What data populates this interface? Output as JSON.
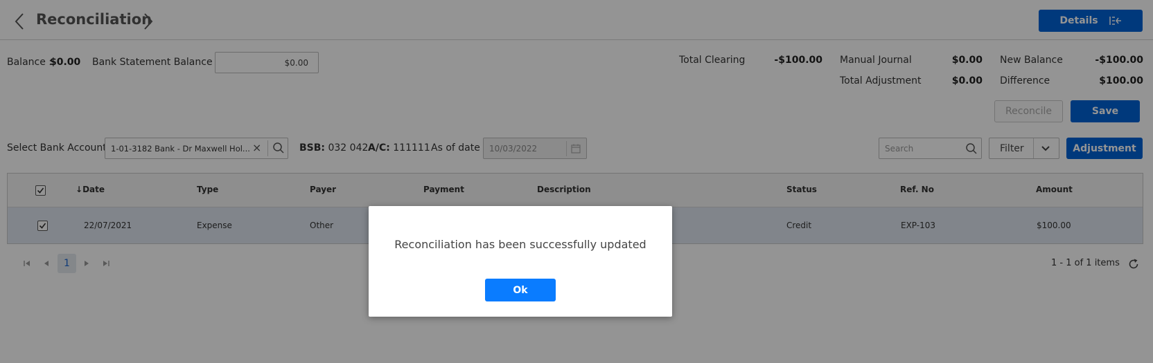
{
  "header": {
    "title": "Reconciliation",
    "details_label": "Details"
  },
  "balance": {
    "balance_label": "Balance :",
    "balance_value": "$0.00",
    "bank_statement_label": "Bank Statement Balance :",
    "bank_statement_value": "$0.00"
  },
  "totals": {
    "total_clearing_label": "Total Clearing",
    "total_clearing_value": "-$100.00",
    "manual_journal_label": "Manual Journal",
    "manual_journal_value": "$0.00",
    "total_adjustment_label": "Total Adjustment",
    "total_adjustment_value": "$0.00",
    "new_balance_label": "New Balance",
    "new_balance_value": "-$100.00",
    "difference_label": "Difference",
    "difference_value": "$100.00"
  },
  "actions": {
    "reconcile_label": "Reconcile",
    "save_label": "Save",
    "filter_label": "Filter",
    "adjustment_label": "Adjustment",
    "search_placeholder": "Search"
  },
  "account": {
    "select_label": "Select Bank Account",
    "selected": "1-01-3182 Bank - Dr Maxwell Hol...",
    "bsb_label": "BSB:",
    "bsb_value": "032 042",
    "ac_label": "A/C:",
    "ac_value": "111111",
    "as_of_label": "As of date",
    "as_of_value": "10/03/2022"
  },
  "grid": {
    "columns": [
      "Date",
      "Type",
      "Payer",
      "Payment",
      "Description",
      "Status",
      "Ref. No",
      "Amount"
    ],
    "sort_indicator": "↓",
    "rows": [
      {
        "checked": true,
        "date": "22/07/2021",
        "type": "Expense",
        "payer": "Other",
        "payment": "",
        "description": "",
        "status": "Credit",
        "ref_no": "EXP-103",
        "amount": "$100.00"
      }
    ]
  },
  "pager": {
    "current_page": "1",
    "info": "1 - 1 of 1 items"
  },
  "modal": {
    "message": "Reconciliation has been successfully updated",
    "ok_label": "Ok"
  }
}
